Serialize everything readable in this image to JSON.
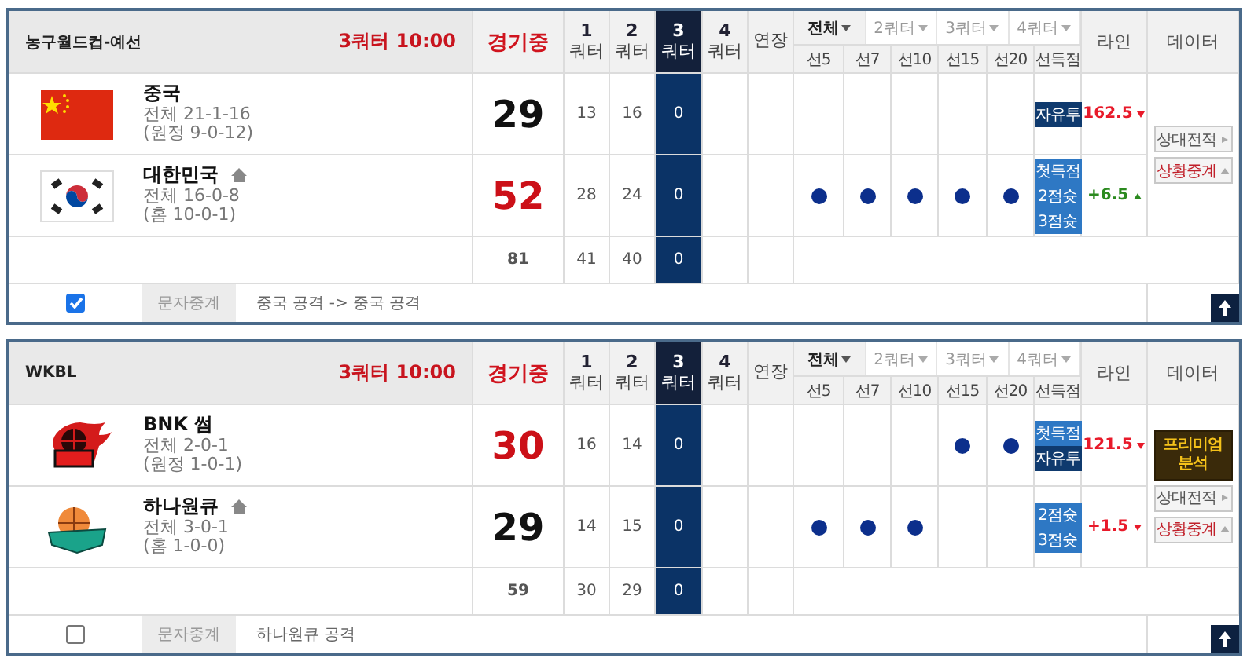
{
  "games": [
    {
      "league": "농구월드컵-예선",
      "clock": "3쿼터 10:00",
      "status": "경기중",
      "quarter_headers": [
        {
          "number": "1",
          "label": "쿼터",
          "current": false
        },
        {
          "number": "2",
          "label": "쿼터",
          "current": false
        },
        {
          "number": "3",
          "label": "쿼터",
          "current": true
        },
        {
          "number": "4",
          "label": "쿼터",
          "current": false
        }
      ],
      "overtime_label": "연장",
      "period_tabs": [
        {
          "label": "전체",
          "selected": true
        },
        {
          "label": "2쿼터",
          "selected": false
        },
        {
          "label": "3쿼터",
          "selected": false
        },
        {
          "label": "4쿼터",
          "selected": false
        }
      ],
      "sub_columns": [
        "선5",
        "선7",
        "선10",
        "선15",
        "선20",
        "선득점"
      ],
      "line_label": "라인",
      "data_label": "데이터",
      "teams": [
        {
          "logo": {
            "kind": "flag-china"
          },
          "name": "중국",
          "home": false,
          "record": "전체 21-1-16",
          "split": "(원정 9-0-12)",
          "score": "29",
          "leading": false,
          "quarters": [
            "13",
            "16",
            "0"
          ],
          "firsts": [
            false,
            false,
            false,
            false,
            false
          ],
          "badges": [
            {
              "label": "자유투",
              "kind": "dark"
            }
          ],
          "line": {
            "value": "162.5",
            "kind": "down"
          }
        },
        {
          "logo": {
            "kind": "flag-korea"
          },
          "name": "대한민국",
          "home": true,
          "record": "전체 16-0-8",
          "split": "(홈 10-0-1)",
          "score": "52",
          "leading": true,
          "quarters": [
            "28",
            "24",
            "0"
          ],
          "firsts": [
            true,
            true,
            true,
            true,
            true
          ],
          "badges": [
            {
              "label": "첫득점",
              "kind": "light"
            },
            {
              "label": "2점슛",
              "kind": "light"
            },
            {
              "label": "3점슛",
              "kind": "light"
            }
          ],
          "line": {
            "value": "+6.5",
            "kind": "up"
          }
        }
      ],
      "totals": {
        "score": "81",
        "quarters": [
          "41",
          "40",
          "0"
        ]
      },
      "data_buttons": [
        {
          "label": "상대전적",
          "kind": "record"
        },
        {
          "label": "상황중계",
          "kind": "live"
        }
      ],
      "live_text": {
        "checked": true,
        "label": "문자중계",
        "message": "중국 공격 -> 중국 공격"
      }
    },
    {
      "league": "WKBL",
      "clock": "3쿼터 10:00",
      "status": "경기중",
      "quarter_headers": [
        {
          "number": "1",
          "label": "쿼터",
          "current": false
        },
        {
          "number": "2",
          "label": "쿼터",
          "current": false
        },
        {
          "number": "3",
          "label": "쿼터",
          "current": true
        },
        {
          "number": "4",
          "label": "쿼터",
          "current": false
        }
      ],
      "overtime_label": "연장",
      "period_tabs": [
        {
          "label": "전체",
          "selected": true
        },
        {
          "label": "2쿼터",
          "selected": false
        },
        {
          "label": "3쿼터",
          "selected": false
        },
        {
          "label": "4쿼터",
          "selected": false
        }
      ],
      "sub_columns": [
        "선5",
        "선7",
        "선10",
        "선15",
        "선20",
        "선득점"
      ],
      "line_label": "라인",
      "data_label": "데이터",
      "teams": [
        {
          "logo": {
            "kind": "logo-flame"
          },
          "name": "BNK 썸",
          "home": false,
          "record": "전체 2-0-1",
          "split": "(원정 1-0-1)",
          "score": "30",
          "leading": true,
          "quarters": [
            "16",
            "14",
            "0"
          ],
          "firsts": [
            false,
            false,
            false,
            true,
            true
          ],
          "badges": [
            {
              "label": "첫득점",
              "kind": "light"
            },
            {
              "label": "자유투",
              "kind": "dark"
            }
          ],
          "line": {
            "value": "121.5",
            "kind": "down"
          }
        },
        {
          "logo": {
            "kind": "logo-ball"
          },
          "name": "하나원큐",
          "home": true,
          "record": "전체 3-0-1",
          "split": "(홈 1-0-0)",
          "score": "29",
          "leading": false,
          "quarters": [
            "14",
            "15",
            "0"
          ],
          "firsts": [
            true,
            true,
            true,
            false,
            false
          ],
          "badges": [
            {
              "label": "2점슛",
              "kind": "light"
            },
            {
              "label": "3점슛",
              "kind": "light"
            }
          ],
          "line": {
            "value": "+1.5",
            "kind": "down"
          }
        }
      ],
      "totals": {
        "score": "59",
        "quarters": [
          "30",
          "29",
          "0"
        ]
      },
      "data_buttons": [
        {
          "label": "프리미엄 분석",
          "kind": "premium"
        },
        {
          "label": "상대전적",
          "kind": "record"
        },
        {
          "label": "상황중계",
          "kind": "live"
        }
      ],
      "live_text": {
        "checked": false,
        "label": "문자중계",
        "message": "하나원큐 공격"
      }
    }
  ]
}
